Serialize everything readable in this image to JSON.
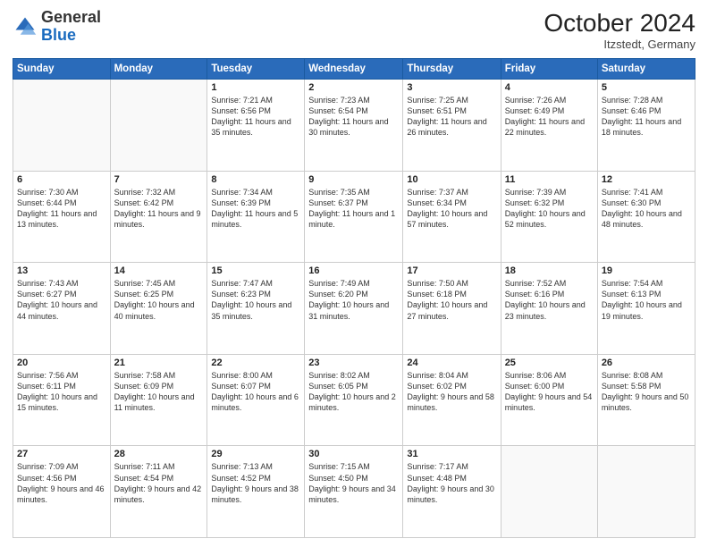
{
  "header": {
    "logo_general": "General",
    "logo_blue": "Blue",
    "month_year": "October 2024",
    "location": "Itzstedt, Germany"
  },
  "days_of_week": [
    "Sunday",
    "Monday",
    "Tuesday",
    "Wednesday",
    "Thursday",
    "Friday",
    "Saturday"
  ],
  "weeks": [
    [
      {
        "day": "",
        "info": ""
      },
      {
        "day": "",
        "info": ""
      },
      {
        "day": "1",
        "info": "Sunrise: 7:21 AM\nSunset: 6:56 PM\nDaylight: 11 hours and 35 minutes."
      },
      {
        "day": "2",
        "info": "Sunrise: 7:23 AM\nSunset: 6:54 PM\nDaylight: 11 hours and 30 minutes."
      },
      {
        "day": "3",
        "info": "Sunrise: 7:25 AM\nSunset: 6:51 PM\nDaylight: 11 hours and 26 minutes."
      },
      {
        "day": "4",
        "info": "Sunrise: 7:26 AM\nSunset: 6:49 PM\nDaylight: 11 hours and 22 minutes."
      },
      {
        "day": "5",
        "info": "Sunrise: 7:28 AM\nSunset: 6:46 PM\nDaylight: 11 hours and 18 minutes."
      }
    ],
    [
      {
        "day": "6",
        "info": "Sunrise: 7:30 AM\nSunset: 6:44 PM\nDaylight: 11 hours and 13 minutes."
      },
      {
        "day": "7",
        "info": "Sunrise: 7:32 AM\nSunset: 6:42 PM\nDaylight: 11 hours and 9 minutes."
      },
      {
        "day": "8",
        "info": "Sunrise: 7:34 AM\nSunset: 6:39 PM\nDaylight: 11 hours and 5 minutes."
      },
      {
        "day": "9",
        "info": "Sunrise: 7:35 AM\nSunset: 6:37 PM\nDaylight: 11 hours and 1 minute."
      },
      {
        "day": "10",
        "info": "Sunrise: 7:37 AM\nSunset: 6:34 PM\nDaylight: 10 hours and 57 minutes."
      },
      {
        "day": "11",
        "info": "Sunrise: 7:39 AM\nSunset: 6:32 PM\nDaylight: 10 hours and 52 minutes."
      },
      {
        "day": "12",
        "info": "Sunrise: 7:41 AM\nSunset: 6:30 PM\nDaylight: 10 hours and 48 minutes."
      }
    ],
    [
      {
        "day": "13",
        "info": "Sunrise: 7:43 AM\nSunset: 6:27 PM\nDaylight: 10 hours and 44 minutes."
      },
      {
        "day": "14",
        "info": "Sunrise: 7:45 AM\nSunset: 6:25 PM\nDaylight: 10 hours and 40 minutes."
      },
      {
        "day": "15",
        "info": "Sunrise: 7:47 AM\nSunset: 6:23 PM\nDaylight: 10 hours and 35 minutes."
      },
      {
        "day": "16",
        "info": "Sunrise: 7:49 AM\nSunset: 6:20 PM\nDaylight: 10 hours and 31 minutes."
      },
      {
        "day": "17",
        "info": "Sunrise: 7:50 AM\nSunset: 6:18 PM\nDaylight: 10 hours and 27 minutes."
      },
      {
        "day": "18",
        "info": "Sunrise: 7:52 AM\nSunset: 6:16 PM\nDaylight: 10 hours and 23 minutes."
      },
      {
        "day": "19",
        "info": "Sunrise: 7:54 AM\nSunset: 6:13 PM\nDaylight: 10 hours and 19 minutes."
      }
    ],
    [
      {
        "day": "20",
        "info": "Sunrise: 7:56 AM\nSunset: 6:11 PM\nDaylight: 10 hours and 15 minutes."
      },
      {
        "day": "21",
        "info": "Sunrise: 7:58 AM\nSunset: 6:09 PM\nDaylight: 10 hours and 11 minutes."
      },
      {
        "day": "22",
        "info": "Sunrise: 8:00 AM\nSunset: 6:07 PM\nDaylight: 10 hours and 6 minutes."
      },
      {
        "day": "23",
        "info": "Sunrise: 8:02 AM\nSunset: 6:05 PM\nDaylight: 10 hours and 2 minutes."
      },
      {
        "day": "24",
        "info": "Sunrise: 8:04 AM\nSunset: 6:02 PM\nDaylight: 9 hours and 58 minutes."
      },
      {
        "day": "25",
        "info": "Sunrise: 8:06 AM\nSunset: 6:00 PM\nDaylight: 9 hours and 54 minutes."
      },
      {
        "day": "26",
        "info": "Sunrise: 8:08 AM\nSunset: 5:58 PM\nDaylight: 9 hours and 50 minutes."
      }
    ],
    [
      {
        "day": "27",
        "info": "Sunrise: 7:09 AM\nSunset: 4:56 PM\nDaylight: 9 hours and 46 minutes."
      },
      {
        "day": "28",
        "info": "Sunrise: 7:11 AM\nSunset: 4:54 PM\nDaylight: 9 hours and 42 minutes."
      },
      {
        "day": "29",
        "info": "Sunrise: 7:13 AM\nSunset: 4:52 PM\nDaylight: 9 hours and 38 minutes."
      },
      {
        "day": "30",
        "info": "Sunrise: 7:15 AM\nSunset: 4:50 PM\nDaylight: 9 hours and 34 minutes."
      },
      {
        "day": "31",
        "info": "Sunrise: 7:17 AM\nSunset: 4:48 PM\nDaylight: 9 hours and 30 minutes."
      },
      {
        "day": "",
        "info": ""
      },
      {
        "day": "",
        "info": ""
      }
    ]
  ]
}
